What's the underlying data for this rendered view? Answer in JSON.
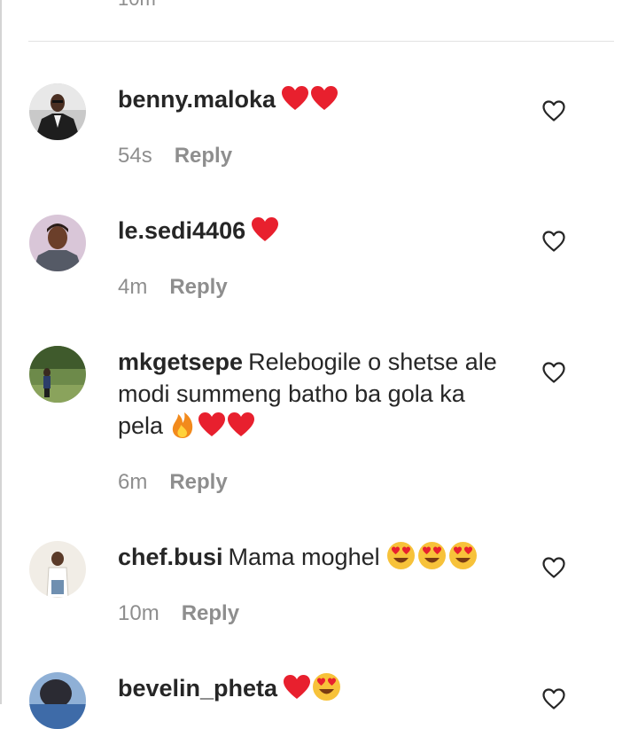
{
  "top": {
    "partial_time": "10m"
  },
  "reply_label": "Reply",
  "comments": [
    {
      "username": "benny.maloka",
      "text": "",
      "emojis": [
        "red-heart",
        "red-heart"
      ],
      "time": "54s"
    },
    {
      "username": "le.sedi4406",
      "text": "",
      "emojis": [
        "red-heart"
      ],
      "time": "4m"
    },
    {
      "username": "mkgetsepe",
      "text": "Relebogile o shetse ale modi summeng batho ba gola ka pela",
      "emojis": [
        "fire",
        "red-heart",
        "red-heart"
      ],
      "time": "6m"
    },
    {
      "username": "chef.busi",
      "text": "Mama moghel",
      "emojis": [
        "heart-eyes",
        "heart-eyes",
        "heart-eyes"
      ],
      "time": "10m"
    },
    {
      "username": "bevelin_pheta",
      "text": "",
      "emojis": [
        "red-heart",
        "heart-eyes"
      ],
      "time": ""
    }
  ],
  "colors": {
    "text": "#262626",
    "muted": "#8e8e8e",
    "divider": "#e2e2e2",
    "heart_red": "#e8202e",
    "emoji_yellow": "#f7c23a"
  }
}
